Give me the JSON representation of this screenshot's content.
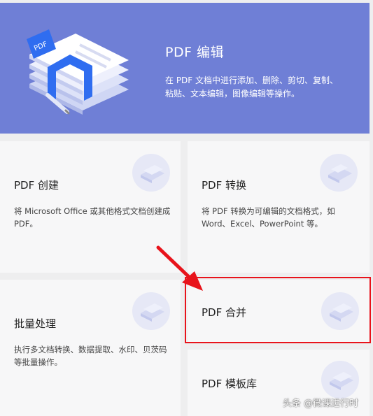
{
  "hero": {
    "title": "PDF 编辑",
    "description": "在 PDF 文档中进行添加、删除、剪切、复制、粘贴、文本编辑，图像编辑等操作。",
    "logo_text": "PDF"
  },
  "cards": [
    {
      "title": "PDF 创建",
      "description": "将 Microsoft Office 或其他格式文档创建成 PDF。",
      "icon": "create-doc-icon"
    },
    {
      "title": "PDF 转换",
      "description": "将 PDF 转换为可编辑的文档格式，如 Word、Excel、PowerPoint 等。",
      "icon": "convert-doc-icon"
    },
    {
      "title": "批量处理",
      "description": "执行多文档转换、数据提取、水印、贝茨码等批量操作。",
      "icon": "batch-doc-icon"
    },
    {
      "title": "PDF 合并",
      "description": "",
      "icon": "merge-doc-icon"
    },
    {
      "title": "PDF 模板库",
      "description": "",
      "icon": "template-doc-icon"
    }
  ],
  "annotation": {
    "highlight_color": "#e8131b",
    "arrow_color": "#e8131b"
  },
  "watermark": "头条 @微课进行时",
  "colors": {
    "hero_bg": "#6f7fd6",
    "card_bg": "#f7f7f8",
    "page_bg": "#eeeeef"
  }
}
